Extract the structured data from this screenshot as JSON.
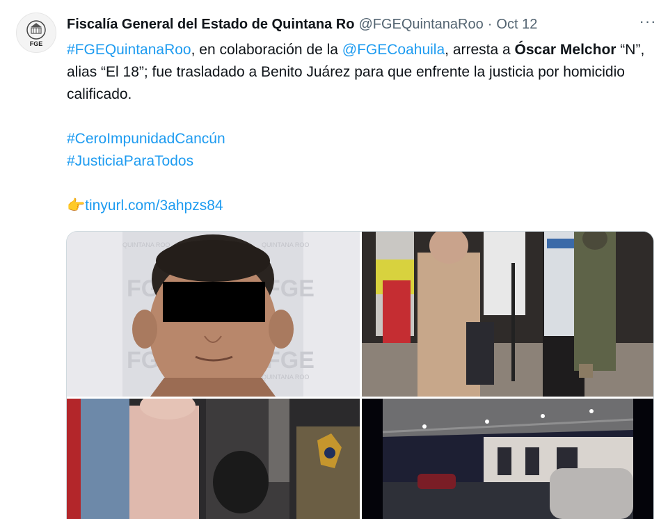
{
  "tweet": {
    "author_name": "Fiscalía General del Estado de Quintana Ro",
    "handle": "@FGEQuintanaRoo",
    "separator": "·",
    "date": "Oct 12",
    "avatar_text": "FGE",
    "more_label": "···",
    "text": {
      "mention1": "#FGEQuintanaRoo",
      "part1": ", en colaboración de la ",
      "mention2": "@FGECoahuila",
      "part2": ", arresta a ",
      "bold1": "Óscar Melchor",
      "part3": " “N”, alias “El 18”; fue trasladado a Benito Juárez para que enfrente la justicia por homicidio calificado.",
      "hashtag1": "#CeroImpunidadCancún",
      "hashtag2": "#JusticiaParaTodos",
      "link_emoji": "👉",
      "link": "tinyurl.com/3ahpzs84"
    }
  },
  "media": {
    "photo1": {
      "watermark_big": "FGE",
      "watermark_small": "QUINTANA ROO"
    }
  }
}
